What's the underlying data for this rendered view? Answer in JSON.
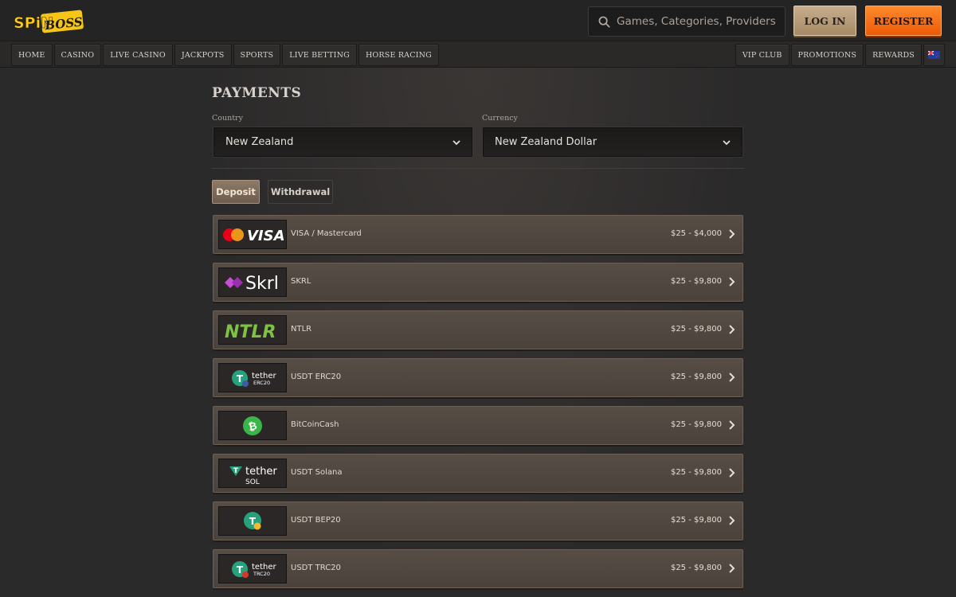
{
  "header": {
    "logo": {
      "part1": "SPiN",
      "part2": "BOSS"
    },
    "search": {
      "placeholder": "Games, Categories, Providers"
    },
    "login_label": "LOG IN",
    "register_label": "REGISTER"
  },
  "nav": {
    "left": [
      "HOME",
      "CASINO",
      "LIVE CASINO",
      "JACKPOTS",
      "SPORTS",
      "LIVE BETTING",
      "HORSE RACING"
    ],
    "right": [
      "VIP CLUB",
      "PROMOTIONS",
      "REWARDS"
    ],
    "flag_icon": "nz-flag-icon"
  },
  "payments": {
    "title": "PAYMENTS",
    "country_label": "Country",
    "country_value": "New Zealand",
    "currency_label": "Currency",
    "currency_value": "New Zealand Dollar",
    "tabs": [
      "Deposit",
      "Withdrawal"
    ],
    "active_tab": "Deposit",
    "methods": [
      {
        "name": "VISA / Mastercard",
        "range": "$25 - $4,000",
        "logo_text": "VISA"
      },
      {
        "name": "SKRL",
        "range": "$25 - $9,800",
        "logo_text": "Skrl"
      },
      {
        "name": "NTLR",
        "range": "$25 - $9,800",
        "logo_text": "NTLR"
      },
      {
        "name": "USDT ERC20",
        "range": "$25 - $9,800",
        "logo_text": "tether",
        "logo_sub": "ERC20"
      },
      {
        "name": "BitCoinCash",
        "range": "$25 - $9,800",
        "logo_text": ""
      },
      {
        "name": "USDT Solana",
        "range": "$25 - $9,800",
        "logo_text": "tether",
        "logo_sub": "SOL"
      },
      {
        "name": "USDT BEP20",
        "range": "$25 - $9,800",
        "logo_text": ""
      },
      {
        "name": "USDT TRC20",
        "range": "$25 - $9,800",
        "logo_text": "tether",
        "logo_sub": "TRC20"
      }
    ]
  },
  "colors": {
    "background": "#2b2a2a",
    "register": "#f26a12",
    "login": "#b99c79",
    "tether": "#26a17b",
    "bitcoin_cash": "#3bb54a",
    "ntlr": "#7dc242",
    "skrl": "#c74fd4"
  }
}
